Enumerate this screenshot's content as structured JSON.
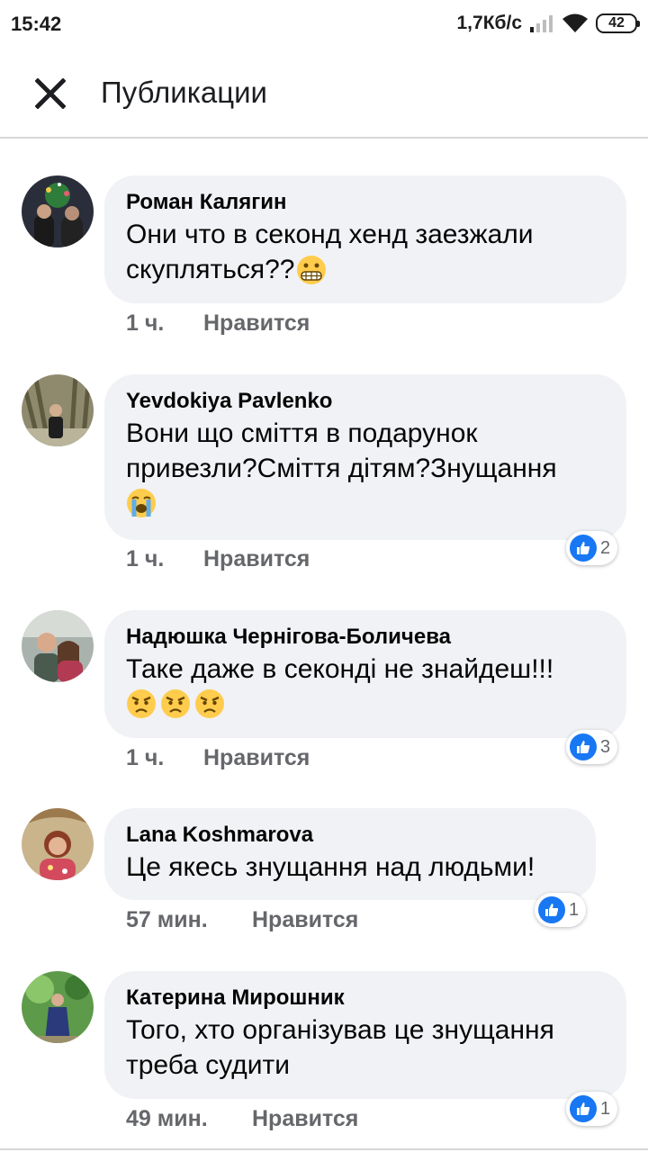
{
  "status_bar": {
    "time": "15:42",
    "speed": "1,7Кб/с",
    "battery": "42"
  },
  "header": {
    "title": "Публикации"
  },
  "comments": [
    {
      "author": "Роман Калягин",
      "lines": [
        "Они что в секонд хенд заезжали",
        "скупляться??"
      ],
      "emojis": [
        "grimacing-face"
      ],
      "time": "1 ч.",
      "like_label": "Нравится",
      "reaction_count": ""
    },
    {
      "author": "Yevdokiya Pavlenko",
      "lines": [
        "Вони що сміття в подарунок",
        "привезли?Сміття дітям?Знущання"
      ],
      "emojis": [
        "loudly-crying-face"
      ],
      "time": "1 ч.",
      "like_label": "Нравится",
      "reaction_count": "2"
    },
    {
      "author": "Надюшка Чернігова-Боличева",
      "lines": [
        "Таке даже в секонді не знайдеш!!!"
      ],
      "emojis": [
        "angry-face",
        "angry-face",
        "angry-face"
      ],
      "time": "1 ч.",
      "like_label": "Нравится",
      "reaction_count": "3"
    },
    {
      "author": "Lana Koshmarova",
      "lines": [
        "Це якесь знущання над людьми!"
      ],
      "emojis": [],
      "time": "57 мин.",
      "like_label": "Нравится",
      "reaction_count": "1"
    },
    {
      "author": "Катерина Мирошник",
      "lines": [
        "Того, хто організував це знущання",
        "треба судити"
      ],
      "emojis": [],
      "time": "49 мин.",
      "like_label": "Нравится",
      "reaction_count": "1"
    }
  ],
  "colors": {
    "bubble": "#f0f2f5",
    "meta_text": "#65676b",
    "like_blue": "#1877f2"
  }
}
